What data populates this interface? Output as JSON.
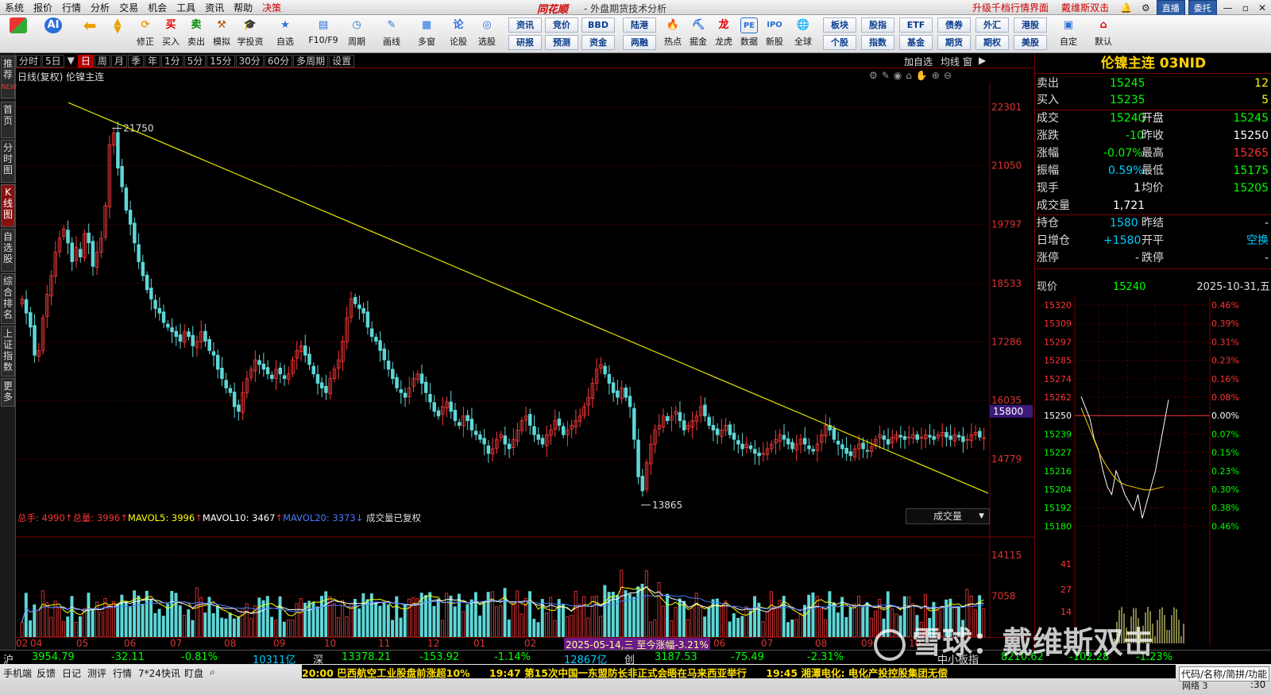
{
  "menubar": {
    "items": [
      "系统",
      "报价",
      "行情",
      "分析",
      "交易",
      "机会",
      "工具",
      "资讯",
      "帮助",
      "决策"
    ],
    "brand": "同花顺",
    "subtitle": "- 外盘期货技术分析",
    "right_links": [
      "升级千档行情界面",
      "戴维斯双击"
    ],
    "btn1": "直播",
    "btn2": "委托"
  },
  "toolbar": {
    "buttons": [
      "修正",
      "买入",
      "卖出",
      "模拟",
      "学投资",
      "自选",
      "F10/F9",
      "周期",
      "画线",
      "多窗",
      "论股",
      "选股",
      "热点",
      "掘金",
      "龙虎",
      "数据",
      "新股",
      "全球",
      "自定",
      "默认"
    ],
    "small_buttons": [
      "资讯",
      "竞价",
      "BBD",
      "陆港",
      "研报",
      "预测",
      "资金",
      "两融",
      "板块",
      "股指",
      "ETF",
      "债券",
      "外汇",
      "港股",
      "个股",
      "指数",
      "基金",
      "期货",
      "期权",
      "美股"
    ]
  },
  "leftnav": [
    "推荐",
    "首页",
    "分时图",
    "K线图",
    "自选股",
    "综合排名",
    "上证指数",
    "更多"
  ],
  "periods": [
    "分时",
    "5日",
    "日",
    "周",
    "月",
    "季",
    "年",
    "1分",
    "5分",
    "15分",
    "30分",
    "60分",
    "多周期",
    "设置"
  ],
  "period_right": [
    "加自选",
    "均线",
    "窗"
  ],
  "chart_title": "日线(复权)  伦镍主连",
  "volume_header": {
    "zongshou": "总手: 4990",
    "zongliang": "总量: 3996",
    "mavol5": "MAVOL5: 3996",
    "mavol10": "MAVOL10: 3467",
    "mavol20": "MAVOL20: 3373",
    "note": "成交量已复权",
    "selector": "成交量"
  },
  "chart_data": {
    "type": "candlestick",
    "instrument": "伦镍主连",
    "price_axis_ticks": [
      22301,
      21050,
      19797,
      18533,
      17286,
      16035,
      14779
    ],
    "current_price_marker": 15800,
    "high_annotation": 21750,
    "low_annotation": 13865,
    "volume_axis_ticks": [
      14115,
      7058
    ],
    "x_labels": [
      "02",
      "04",
      "05",
      "06",
      "07",
      "08",
      "09",
      "10",
      "11",
      "12",
      "01",
      "02",
      "2025-05-14,三 至今涨幅-3.21%",
      "06",
      "07",
      "08",
      "09",
      "10"
    ],
    "trendline": {
      "from_price": 22400,
      "to_price": 14050
    },
    "closes": [
      18200,
      17900,
      17600,
      17000,
      17100,
      17800,
      18300,
      18700,
      19200,
      19500,
      19700,
      19400,
      19000,
      19300,
      19100,
      19600,
      19400,
      18900,
      19200,
      19500,
      20200,
      21500,
      21750,
      21000,
      20600,
      20100,
      19800,
      19400,
      19000,
      18700,
      18400,
      18200,
      18000,
      17900,
      17700,
      17600,
      17500,
      17400,
      17300,
      17500,
      17400,
      17200,
      17300,
      17500,
      17300,
      17100,
      17000,
      16700,
      16500,
      16300,
      16200,
      15900,
      15800,
      16200,
      16500,
      16700,
      16900,
      16800,
      16700,
      16600,
      16500,
      16700,
      16600,
      16500,
      16600,
      16900,
      17100,
      17200,
      17000,
      16800,
      16600,
      16400,
      16300,
      16200,
      16500,
      16700,
      16900,
      17300,
      17800,
      18200,
      18100,
      18000,
      17900,
      17600,
      17400,
      17300,
      17100,
      16900,
      16700,
      16500,
      16300,
      16200,
      16100,
      16300,
      16500,
      16600,
      16400,
      16200,
      16000,
      15800,
      15700,
      15900,
      16000,
      15800,
      15600,
      15500,
      15700,
      15600,
      15400,
      15300,
      15200,
      15100,
      14900,
      15000,
      15200,
      15300,
      15100,
      15000,
      15200,
      15400,
      15600,
      15700,
      15500,
      15300,
      15200,
      15100,
      15300,
      15400,
      15600,
      15500,
      15300,
      15400,
      15500,
      15600,
      15700,
      15900,
      16100,
      16400,
      16700,
      16800,
      16600,
      16400,
      16200,
      16100,
      16300,
      16100,
      15900,
      15200,
      14400,
      14100,
      14700,
      15100,
      15400,
      15500,
      15700,
      15600,
      15700,
      15800,
      15600,
      15400,
      15500,
      15600,
      15700,
      15900,
      15700,
      15500,
      15400,
      15300,
      15400,
      15500,
      15300,
      15200,
      15100,
      15000,
      15100,
      15000,
      14900,
      14850,
      14900,
      15000,
      15100,
      15200,
      15300,
      15200,
      15100,
      15000,
      15100,
      15200,
      15100,
      15000,
      14950,
      15100,
      15300,
      15500,
      15400,
      15200,
      15100,
      15000,
      14900,
      14850,
      15000,
      15100,
      15000,
      14950,
      15050,
      15200,
      15300,
      15200,
      15100,
      15250,
      15300,
      15250,
      15200,
      15250,
      15300,
      15200,
      15250,
      15300,
      15250,
      15200,
      15300,
      15350,
      15250,
      15200,
      15300,
      15250,
      15150,
      15200,
      15300,
      15350,
      15250,
      15240
    ]
  },
  "right_panel": {
    "title": "伦镍主连  03NID",
    "sell_label": "卖出",
    "sell_price": "15245",
    "sell_vol": "12",
    "buy_label": "买入",
    "buy_price": "15235",
    "buy_vol": "5",
    "r1": {
      "l1": "成交",
      "v1": "15240",
      "l2": "开盘",
      "v2": "15245"
    },
    "r2": {
      "l1": "涨跌",
      "v1": "-10",
      "l2": "昨收",
      "v2": "15250"
    },
    "r3": {
      "l1": "涨幅",
      "v1": "-0.07%",
      "l2": "最高",
      "v2": "15265"
    },
    "r4": {
      "l1": "振幅",
      "v1": "0.59%",
      "l2": "最低",
      "v2": "15175"
    },
    "r5": {
      "l1": "现手",
      "v1": "1",
      "l2": "均价",
      "v2": "15205"
    },
    "r6": {
      "l1": "成交量",
      "v1": "1,721"
    },
    "r7": {
      "l1": "持仓",
      "v1": "1580",
      "l2": "昨结",
      "v2": "-"
    },
    "r8": {
      "l1": "日增仓",
      "v1": "+1580",
      "l2": "开平",
      "v2": "空换"
    },
    "r9": {
      "l1": "涨停",
      "v1": "-",
      "l2": "跌停",
      "v2": "-"
    },
    "now_label": "现价",
    "now_price": "15240",
    "now_date": "2025-10-31,五",
    "mini_left_ticks": [
      "15320",
      "15309",
      "15297",
      "15285",
      "15274",
      "15262",
      "15250",
      "15239",
      "15227",
      "15216",
      "15204",
      "15192",
      "15180"
    ],
    "mini_right_ticks": [
      "0.46%",
      "0.39%",
      "0.31%",
      "0.23%",
      "0.16%",
      "0.08%",
      "0.00%",
      "0.07%",
      "0.15%",
      "0.23%",
      "0.30%",
      "0.38%",
      "0.46%"
    ],
    "mini_vol_ticks": [
      "41",
      "27",
      "14"
    ]
  },
  "statusbar": {
    "sh_label": "沪",
    "sh_val": "3954.79",
    "sh_chg": "-32.11",
    "sh_pct": "-0.81%",
    "sh_amt": "10311亿",
    "sz_label": "深",
    "sz_val": "13378.21",
    "sz_chg": "-153.92",
    "sz_pct": "-1.14%",
    "sz_amt": "12867亿",
    "cy_label": "创",
    "cy_val": "3187.53",
    "cy_chg": "-75.49",
    "cy_pct": "-2.31%",
    "zx_label": "中小板指",
    "zx_val": "8210.62",
    "zx_chg": "-102.28",
    "zx_pct": "-1.23%"
  },
  "bottombar": {
    "items": [
      "手机端",
      "反馈",
      "日记",
      "测评",
      "行情",
      "7*24快讯",
      "盯盘"
    ],
    "news": [
      "20:00 巴西航空工业股盘前涨超10%",
      "19:47 第15次中国一东盟防长非正式会晤在马来西亚举行",
      "19:45 湘潭电化: 电化产投控股集团无偿"
    ],
    "right": "代码/名称/简拼/功能",
    "net": "网络 3",
    "time": ":30"
  },
  "watermark": "雪球：戴维斯双击"
}
